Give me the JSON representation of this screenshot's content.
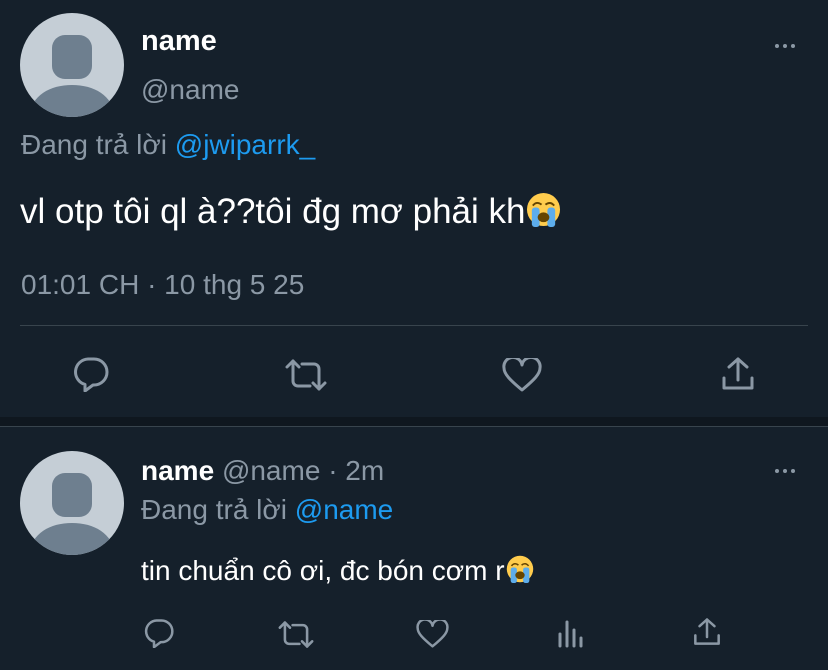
{
  "main_tweet": {
    "name": "name",
    "handle": "@name",
    "replying_prefix": "Đang trả lời",
    "replying_to": "@jwiparrk_",
    "text": "vl otp tôi ql à??tôi đg mơ phải kh",
    "text_emoji": "loudly-crying-face",
    "timestamp": "01:01 CH · 10 thg 5 25",
    "actions": [
      "reply-icon",
      "retweet-icon",
      "like-icon",
      "share-icon"
    ]
  },
  "reply_tweet": {
    "name": "name",
    "handle": "@name",
    "dot": "·",
    "time_ago": "2m",
    "replying_prefix": "Đang trả lời",
    "replying_to": "@name",
    "text": "tin chuẩn cô ơi, đc bón cơm r",
    "text_emoji": "loudly-crying-face",
    "actions": [
      "reply-icon",
      "retweet-icon",
      "like-icon",
      "analytics-icon",
      "share-icon"
    ]
  },
  "colors": {
    "background": "#15202b",
    "text": "#ffffff",
    "muted": "#8b98a5",
    "link": "#1d9bf0",
    "divider": "#38444d",
    "avatar": "#c5ced6"
  }
}
